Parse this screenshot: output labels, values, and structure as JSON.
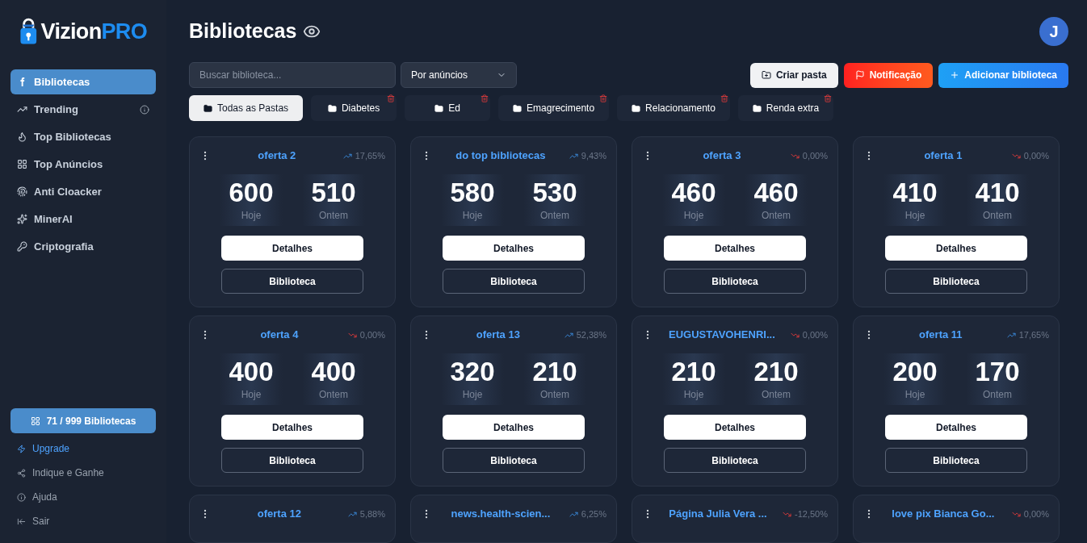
{
  "logo": {
    "word_1": "Vizion",
    "word_2": "PRO"
  },
  "sidebar": {
    "items": [
      {
        "label": "Bibliotecas",
        "selected": true,
        "info": false
      },
      {
        "label": "Trending",
        "selected": false,
        "info": true
      },
      {
        "label": "Top Bibliotecas",
        "selected": false,
        "info": false
      },
      {
        "label": "Top Anúncios",
        "selected": false,
        "info": false
      },
      {
        "label": "Anti Cloacker",
        "selected": false,
        "info": false
      },
      {
        "label": "MinerAI",
        "selected": false,
        "info": false
      },
      {
        "label": "Criptografia",
        "selected": false,
        "info": false
      }
    ],
    "quota": "71 / 999 Bibliotecas",
    "footer": [
      {
        "label": "Upgrade",
        "highlight": true
      },
      {
        "label": "Indique e Ganhe",
        "highlight": false
      },
      {
        "label": "Ajuda",
        "highlight": false
      },
      {
        "label": "Sair",
        "highlight": false
      }
    ]
  },
  "header": {
    "title": "Bibliotecas",
    "avatar": "J"
  },
  "search": {
    "placeholder": "Buscar biblioteca..."
  },
  "sort": {
    "value": "Por anúncios"
  },
  "actions": [
    {
      "label": "Criar pasta",
      "kind": "light"
    },
    {
      "label": "Notificação",
      "kind": "red"
    },
    {
      "label": "Adicionar biblioteca",
      "kind": "blue"
    }
  ],
  "folders": [
    {
      "label": "Todas as Pastas",
      "selected": true,
      "deletable": false
    },
    {
      "label": "Diabetes",
      "selected": false,
      "deletable": true
    },
    {
      "label": "Ed",
      "selected": false,
      "deletable": true
    },
    {
      "label": "Emagrecimento",
      "selected": false,
      "deletable": true
    },
    {
      "label": "Relacionamento",
      "selected": false,
      "deletable": true
    },
    {
      "label": "Renda extra",
      "selected": false,
      "deletable": true
    }
  ],
  "cards": [
    {
      "name": "oferta 2",
      "kind": "up",
      "change": "17,65%",
      "today": "600",
      "today_label": "Hoje",
      "yesterday": "510",
      "yesterday_label": "Ontem",
      "details": "Detalhes",
      "library": "Biblioteca"
    },
    {
      "name": "do top bibliotecas",
      "kind": "up",
      "change": "9,43%",
      "today": "580",
      "today_label": "Hoje",
      "yesterday": "530",
      "yesterday_label": "Ontem",
      "details": "Detalhes",
      "library": "Biblioteca"
    },
    {
      "name": "oferta 3",
      "kind": "down",
      "change": "0,00%",
      "today": "460",
      "today_label": "Hoje",
      "yesterday": "460",
      "yesterday_label": "Ontem",
      "details": "Detalhes",
      "library": "Biblioteca"
    },
    {
      "name": "oferta 1",
      "kind": "down",
      "change": "0,00%",
      "today": "410",
      "today_label": "Hoje",
      "yesterday": "410",
      "yesterday_label": "Ontem",
      "details": "Detalhes",
      "library": "Biblioteca"
    },
    {
      "name": "oferta 4",
      "kind": "down",
      "change": "0,00%",
      "today": "400",
      "today_label": "Hoje",
      "yesterday": "400",
      "yesterday_label": "Ontem",
      "details": "Detalhes",
      "library": "Biblioteca"
    },
    {
      "name": "oferta 13",
      "kind": "up",
      "change": "52,38%",
      "today": "320",
      "today_label": "Hoje",
      "yesterday": "210",
      "yesterday_label": "Ontem",
      "details": "Detalhes",
      "library": "Biblioteca"
    },
    {
      "name": "EUGUSTAVOHENRI...",
      "kind": "down",
      "change": "0,00%",
      "today": "210",
      "today_label": "Hoje",
      "yesterday": "210",
      "yesterday_label": "Ontem",
      "details": "Detalhes",
      "library": "Biblioteca"
    },
    {
      "name": "oferta 11",
      "kind": "up",
      "change": "17,65%",
      "today": "200",
      "today_label": "Hoje",
      "yesterday": "170",
      "yesterday_label": "Ontem",
      "details": "Detalhes",
      "library": "Biblioteca"
    },
    {
      "name": "oferta 12",
      "kind": "up",
      "change": "5,88%"
    },
    {
      "name": "news.health-scien...",
      "kind": "up",
      "change": "6,25%"
    },
    {
      "name": "Página Julia Vera ...",
      "kind": "down",
      "change": "-12,50%"
    },
    {
      "name": "love pix Bianca Go...",
      "kind": "down",
      "change": "0,00%"
    }
  ]
}
